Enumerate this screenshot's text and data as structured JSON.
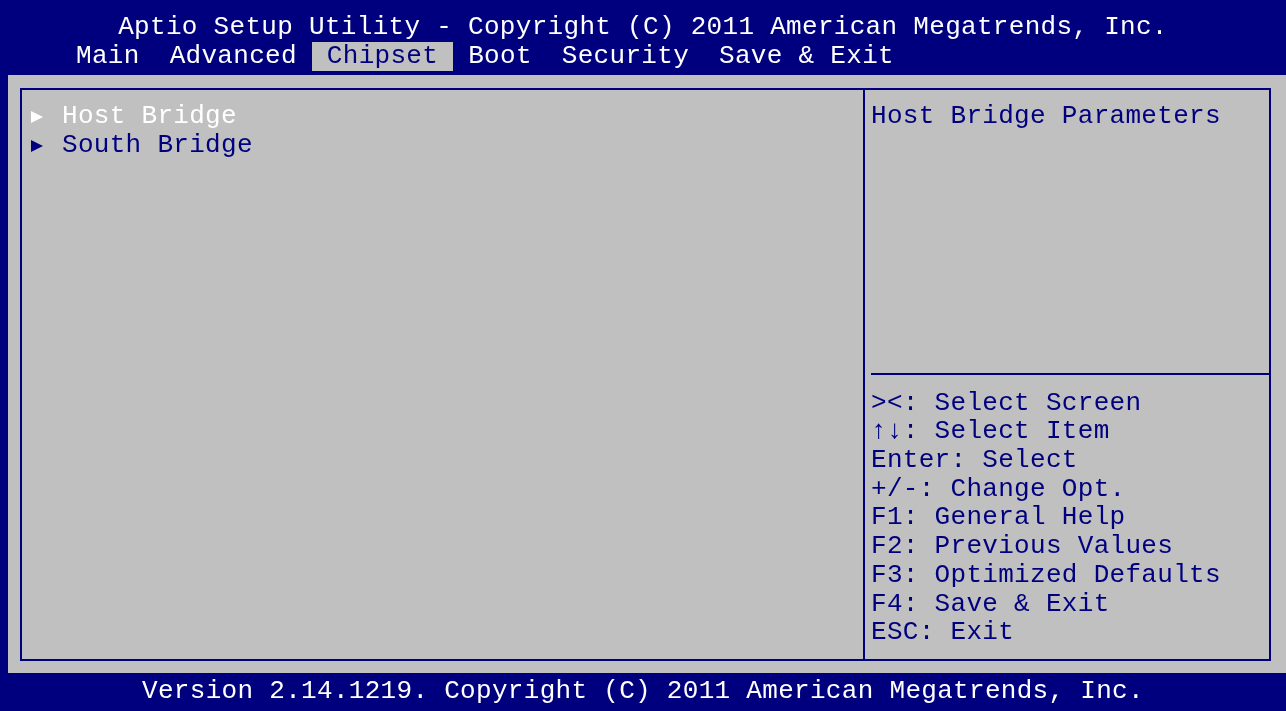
{
  "header": {
    "title": "Aptio Setup Utility - Copyright (C) 2011 American Megatrends, Inc."
  },
  "tabs": [
    {
      "label": "Main",
      "selected": false
    },
    {
      "label": "Advanced",
      "selected": false
    },
    {
      "label": "Chipset",
      "selected": true
    },
    {
      "label": "Boot",
      "selected": false
    },
    {
      "label": "Security",
      "selected": false
    },
    {
      "label": "Save & Exit",
      "selected": false
    }
  ],
  "menu_items": [
    {
      "label": "Host Bridge",
      "selected": true
    },
    {
      "label": "South Bridge",
      "selected": false
    }
  ],
  "help": {
    "description": "Host Bridge Parameters",
    "key_hints": [
      "><: Select Screen",
      "↑↓: Select Item",
      "Enter: Select",
      "+/-: Change Opt.",
      "F1: General Help",
      "F2: Previous Values",
      "F3: Optimized Defaults",
      "F4: Save & Exit",
      "ESC: Exit"
    ]
  },
  "footer": {
    "text": "Version 2.14.1219. Copyright (C) 2011 American Megatrends, Inc."
  }
}
